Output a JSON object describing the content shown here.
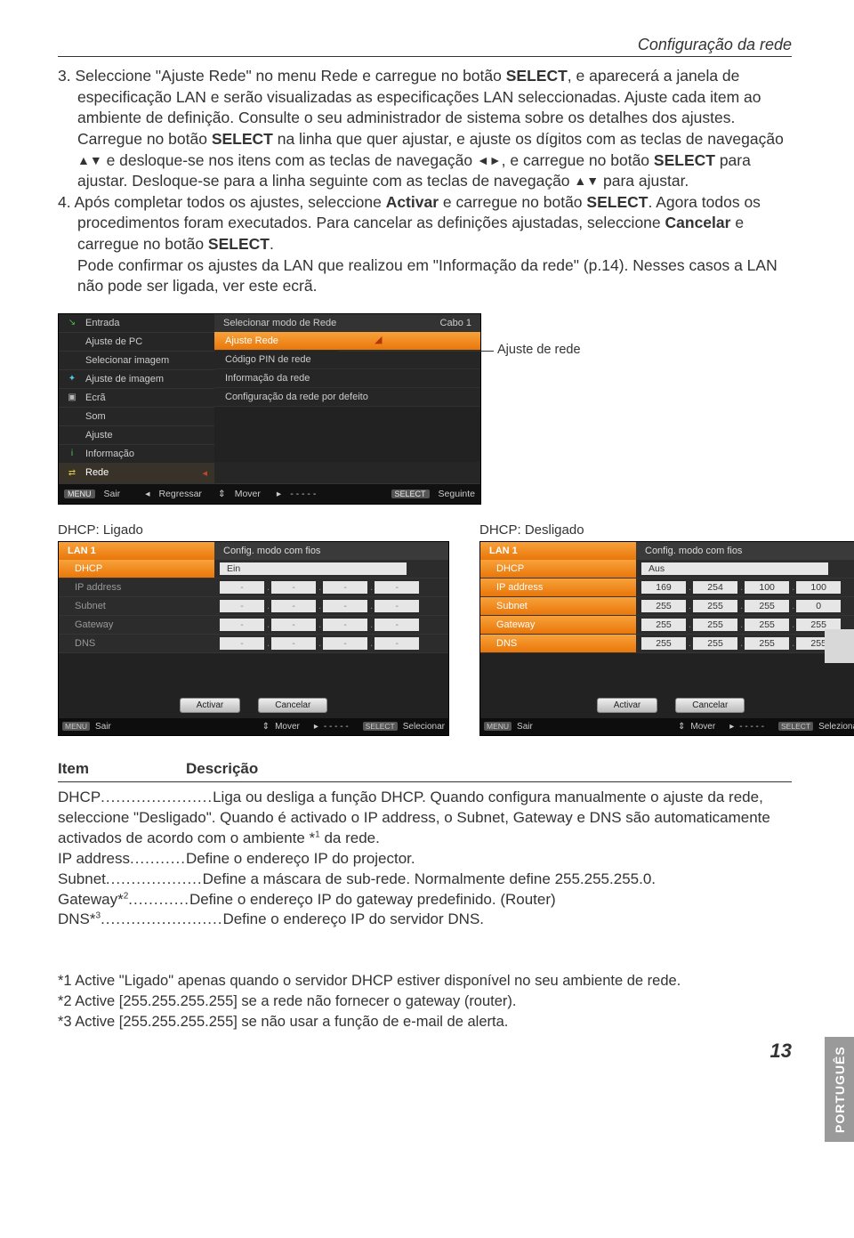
{
  "header": {
    "title": "Configuração da rede"
  },
  "body": {
    "p1_a": "3. Seleccione \"Ajuste Rede\" no menu Rede e carregue no botão ",
    "p1_b": "SELECT",
    "p1_c": ", e aparecerá a janela de especificação LAN e serão visualizadas as especificações LAN seleccionadas. Ajuste cada item ao ambiente de definição. Consulte o seu administrador de sistema sobre os detalhes dos ajustes.",
    "p2_a": "Carregue no botão ",
    "p2_b": "SELECT",
    "p2_c": " na linha que quer ajustar, e ajuste os dígitos com as teclas de navegação ",
    "p2_d": " e desloque-se nos itens com as teclas de navegação ",
    "p2_e": ", e carregue no botão ",
    "p2_f": "SELECT",
    "p2_g": " para ajustar. Desloque-se para a linha seguinte com as teclas de navegação ",
    "p2_h": " para ajustar.",
    "p3_a": "4. Após completar todos os ajustes, seleccione ",
    "p3_b": "Activar",
    "p3_c": " e carregue no botão ",
    "p3_d": "SELECT",
    "p3_e": ". Agora todos os procedimentos foram executados. Para cancelar as definições ajustadas, seleccione ",
    "p3_f": "Cancelar",
    "p3_g": " e carregue no botão ",
    "p3_h": "SELECT",
    "p3_i": ".",
    "p4": "Pode confirmar os ajustes da LAN que realizou em \"Informação da rede\" (p.14). Nesses casos a LAN não pode ser ligada, ver este ecrã."
  },
  "menu": {
    "left": [
      "Entrada",
      "Ajuste de PC",
      "Selecionar imagem",
      "Ajuste de imagem",
      "Ecrã",
      "Som",
      "Ajuste",
      "Informação",
      "Rede"
    ],
    "left_icons": [
      "↘",
      "",
      "",
      "✦",
      "▣",
      "",
      "",
      "i",
      "⇄"
    ],
    "left_icon_colors": [
      "#4dbb4d",
      "#bbb",
      "#bbb",
      "#52c8e0",
      "#bbb",
      "#bbb",
      "#d98c3a",
      "#5ec25e",
      "#d9c84a"
    ],
    "right_head_a": "Selecionar modo de Rede",
    "right_head_b": "Cabo 1",
    "right_items": [
      "Ajuste Rede",
      "Código PIN de rede",
      "Informação da rede",
      "Configuração da rede por defeito"
    ],
    "footer": {
      "k1": "MENU",
      "t1": "Sair",
      "t2": "Regressar",
      "t3": "Mover",
      "t4": "- - - - -",
      "k2": "SELECT",
      "t5": "Seguinte"
    }
  },
  "callout": "Ajuste de rede",
  "lan": {
    "cap_on": "DHCP: Ligado",
    "cap_off": "DHCP: Desligado",
    "head_a": "LAN 1",
    "head_b": "Config. modo com fios",
    "labels": [
      "DHCP",
      "IP address",
      "Subnet",
      "Gateway",
      "DNS"
    ],
    "on_val": "Ein",
    "off_val": "Aus",
    "off_rows": [
      [
        "169",
        "254",
        "100",
        "100"
      ],
      [
        "255",
        "255",
        "255",
        "0"
      ],
      [
        "255",
        "255",
        "255",
        "255"
      ],
      [
        "255",
        "255",
        "255",
        "255"
      ]
    ],
    "btn1": "Activar",
    "btn2": "Cancelar",
    "footer": {
      "k1": "MENU",
      "t1": "Sair",
      "t2": "Mover",
      "t3": "- - - - -",
      "k2": "SELECT",
      "t4a": "Selecionar",
      "t4b": "Seleziona"
    }
  },
  "defs": {
    "h1": "Item",
    "h2": "Descrição",
    "r1t": "DHCP",
    "r1d": "Liga ou desliga a função DHCP. Quando configura manualmente o ajuste da rede, seleccione \"Desligado\". Quando é activado o IP address, o Subnet, Gateway e DNS são automaticamente activados de acordo com o ambiente *",
    "r1s": "1",
    "r1e": " da rede.",
    "r2t": "IP address",
    "r2d": "Define o endereço IP do projector.",
    "r3t": "Subnet",
    "r3d": "Define a máscara de sub-rede. Normalmente define 255.255.255.0.",
    "r4t": "Gateway*",
    "r4s": "2",
    "r4d": "Define o endereço IP do gateway predefinido. (Router)",
    "r5t": "DNS*",
    "r5s": "3",
    "r5d": "Define o endereço IP do servidor DNS."
  },
  "footnotes": {
    "f1": "*1 Active \"Ligado\" apenas quando o servidor DHCP estiver disponível no seu ambiente de rede.",
    "f2": "*2 Active [255.255.255.255] se a rede não fornecer o gateway (router).",
    "f3": "*3 Active [255.255.255.255] se não usar a função de e-mail de alerta."
  },
  "sidetab": "PORTUGUÊS",
  "pageno": "13"
}
